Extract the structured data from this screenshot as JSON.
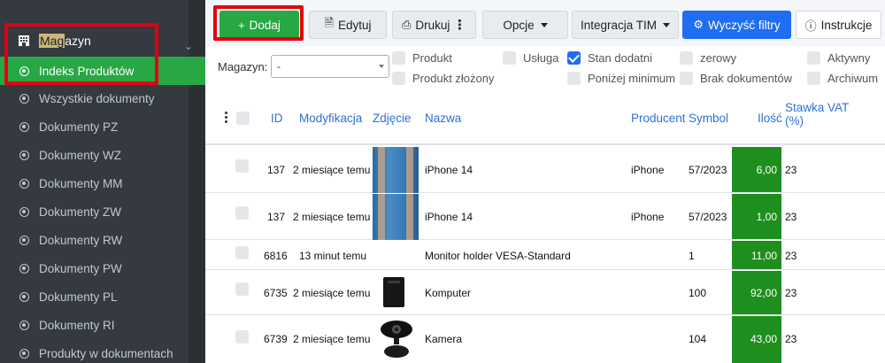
{
  "sidebar": {
    "section_prefix": "",
    "section_highlight": "Mag",
    "section_rest": "azyn",
    "items": [
      {
        "label": "Indeks Produktów"
      },
      {
        "label": "Wszystkie dokumenty"
      },
      {
        "label": "Dokumenty PZ"
      },
      {
        "label": "Dokumenty WZ"
      },
      {
        "label": "Dokumenty MM"
      },
      {
        "label": "Dokumenty ZW"
      },
      {
        "label": "Dokumenty RW"
      },
      {
        "label": "Dokumenty PW"
      },
      {
        "label": "Dokumenty PL"
      },
      {
        "label": "Dokumenty RI"
      },
      {
        "label": "Produkty w dokumentach"
      }
    ]
  },
  "toolbar": {
    "add": "Dodaj",
    "edit": "Edytuj",
    "print": "Drukuj",
    "options": "Opcje",
    "tim": "Integracja TIM",
    "clear_filters": "Wyczyść filtry",
    "instructions": "Instrukcje"
  },
  "filters": {
    "warehouse_label": "Magazyn:",
    "warehouse_value": "-",
    "checkboxes": [
      {
        "label": "Produkt",
        "checked": false
      },
      {
        "label": "Usługa",
        "checked": false
      },
      {
        "label": "Stan dodatni",
        "checked": true
      },
      {
        "label": "zerowy",
        "checked": false
      },
      {
        "label": "Aktywny",
        "checked": false
      },
      {
        "label": "Produkt złożony",
        "checked": false
      },
      {
        "label": "Poniżej minimum",
        "checked": false
      },
      {
        "label": "Brak dokumentów",
        "checked": false
      },
      {
        "label": "Archiwum",
        "checked": false
      }
    ]
  },
  "table": {
    "headers": {
      "id": "ID",
      "modified": "Modyfikacja",
      "image": "Zdjęcie",
      "name": "Nazwa",
      "producer": "Producent",
      "symbol": "Symbol",
      "qty": "Ilość",
      "vat_line1": "Stawka VAT",
      "vat_line2": "(%)"
    },
    "rows": [
      {
        "id": "137",
        "modified": "2 miesiące temu",
        "image": "phone",
        "name": "iPhone 14",
        "producer": "iPhone",
        "symbol": "57/2023",
        "qty": "6,00",
        "vat": "23"
      },
      {
        "id": "137",
        "modified": "2 miesiące temu",
        "image": "phone",
        "name": "iPhone 14",
        "producer": "iPhone",
        "symbol": "57/2023",
        "qty": "1,00",
        "vat": "23"
      },
      {
        "id": "6816",
        "modified": "13 minut temu",
        "image": "",
        "name": "Monitor holder VESA-Standard",
        "producer": "",
        "symbol": "1",
        "qty": "11,00",
        "vat": "23"
      },
      {
        "id": "6735",
        "modified": "2 miesiące temu",
        "image": "computer",
        "name": "Komputer",
        "producer": "",
        "symbol": "100",
        "qty": "92,00",
        "vat": "23"
      },
      {
        "id": "6739",
        "modified": "2 miesiące temu",
        "image": "camera",
        "name": "Kamera",
        "producer": "",
        "symbol": "104",
        "qty": "43,00",
        "vat": "23"
      }
    ]
  },
  "colors": {
    "sidebar_bg": "#343a40",
    "active_green": "#28a745",
    "qty_green": "#1e8f1e",
    "primary_blue": "#1f6df2",
    "highlight_red": "#e3000f"
  }
}
